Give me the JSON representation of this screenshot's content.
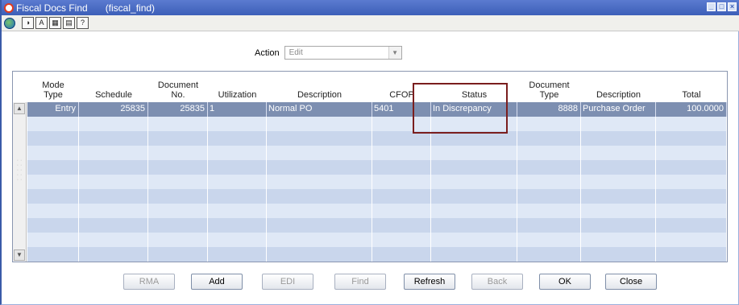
{
  "window": {
    "title": "Fiscal Docs Find",
    "form_id": "(fiscal_find)"
  },
  "toolbar": {
    "icons": [
      "globe-icon",
      "help-wizard-icon",
      "find-icon",
      "calendar-icon",
      "print-icon",
      "help-icon"
    ]
  },
  "action": {
    "label": "Action",
    "value": "Edit"
  },
  "grid": {
    "headers": [
      {
        "line1": "Mode",
        "line2": "Type"
      },
      {
        "line1": "",
        "line2": "Schedule"
      },
      {
        "line1": "Document",
        "line2": "No."
      },
      {
        "line1": "",
        "line2": "Utilization"
      },
      {
        "line1": "",
        "line2": "Description"
      },
      {
        "line1": "",
        "line2": "CFOP"
      },
      {
        "line1": "",
        "line2": "Status"
      },
      {
        "line1": "Document",
        "line2": "Type"
      },
      {
        "line1": "",
        "line2": "Description"
      },
      {
        "line1": "",
        "line2": "Total"
      }
    ],
    "row": {
      "mode_type": "Entry",
      "schedule": "25835",
      "document_no": "25835",
      "utilization": "1",
      "description": "Normal PO",
      "cfop": "5401",
      "status": "In Discrepancy",
      "document_type": "8888",
      "type_description": "Purchase Order",
      "total": "100.0000"
    }
  },
  "buttons": {
    "rma": "RMA",
    "add": "Add",
    "edi": "EDI",
    "find": "Find",
    "refresh": "Refresh",
    "back": "Back",
    "ok": "OK",
    "close": "Close"
  },
  "colors": {
    "titlebar": "#4a6cc4",
    "selected_row": "#7d8fb1",
    "empty_row": "#dfe8f6",
    "highlight_box": "#7a1e1e"
  }
}
